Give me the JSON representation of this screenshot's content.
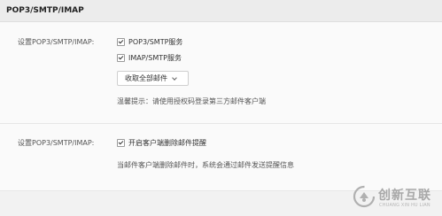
{
  "header": {
    "title": "POP3/SMTP/IMAP"
  },
  "section1": {
    "label": "设置POP3/SMTP/IMAP:",
    "options": [
      {
        "label": "POP3/SMTP服务",
        "checked": true
      },
      {
        "label": "IMAP/SMTP服务",
        "checked": true
      }
    ],
    "dropdown": {
      "value": "收取全部邮件"
    },
    "hint": "温馨提示：请使用授权码登录第三方邮件客户端"
  },
  "section2": {
    "label": "设置POP3/SMTP/IMAP:",
    "option": {
      "label": "开启客户端删除邮件提醒",
      "checked": true
    },
    "hint": "当邮件客户端删除邮件时，系统会通过邮件发送提醒信息"
  },
  "watermark": {
    "brand": "创新互联",
    "sub": "CHUANG XIN HU LIAN"
  },
  "colors": {
    "header_bg": "#ececec",
    "panel_bg": "#fafafa",
    "text": "#333333"
  }
}
